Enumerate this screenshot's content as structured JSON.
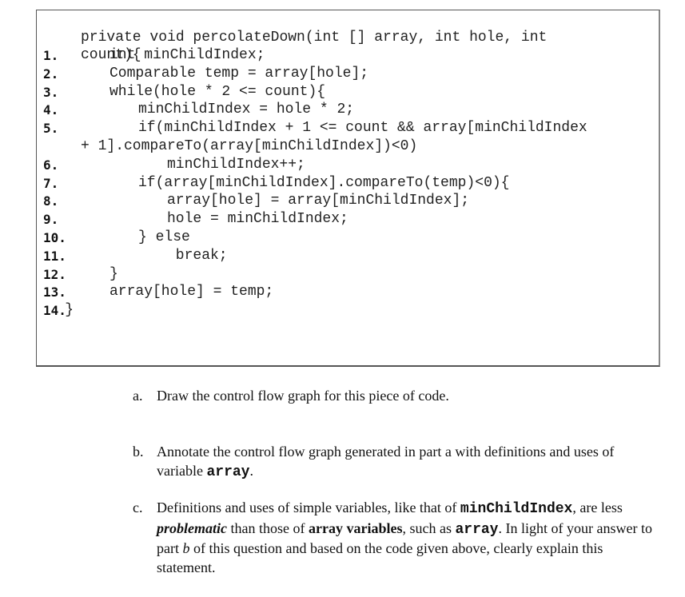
{
  "code": {
    "header": [
      "private void percolateDown(int [] array, int hole, int",
      "count){"
    ],
    "lines": [
      {
        "num": "1.",
        "text": "int minChildIndex;",
        "indent": 1
      },
      {
        "num": "2.",
        "text": "Comparable temp = array[hole];",
        "indent": 1
      },
      {
        "num": "3.",
        "text": "while(hole * 2 <= count){",
        "indent": 1
      },
      {
        "num": "4.",
        "text": "minChildIndex = hole * 2;",
        "indent": 2
      },
      {
        "num": "5.",
        "text": "if(minChildIndex + 1 <= count && array[minChildIndex",
        "indent": 2
      },
      {
        "num": "",
        "text": "+ 1].compareTo(array[minChildIndex])<0)",
        "indent": 0
      },
      {
        "num": "6.",
        "text": "minChildIndex++;",
        "indent": 3
      },
      {
        "num": "7.",
        "text": "if(array[minChildIndex].compareTo(temp)<0){",
        "indent": 2
      },
      {
        "num": "8.",
        "text": "array[hole] = array[minChildIndex];",
        "indent": 3
      },
      {
        "num": "9.",
        "text": "hole = minChildIndex;",
        "indent": 3
      },
      {
        "num": "10.",
        "text": "} else",
        "indent": 2
      },
      {
        "num": "11.",
        "text": "break;",
        "indent": 3.3
      },
      {
        "num": "12.",
        "text": "}",
        "indent": 1
      },
      {
        "num": "13.",
        "text": "array[hole] = temp;",
        "indent": 1
      },
      {
        "num": "14.",
        "text": "}",
        "indent": -0.55
      }
    ]
  },
  "questions": {
    "a": {
      "label": "a.",
      "text": "Draw the control flow graph for this piece of code."
    },
    "b": {
      "label": "b.",
      "text_before": "Annotate the control flow graph generated in part a with definitions and uses of variable ",
      "code": "array",
      "text_after": "."
    },
    "c": {
      "label": "c.",
      "t1": "Definitions and uses of simple variables, like that of ",
      "code1": "minChildIndex",
      "t2": ", are less ",
      "emph1": "problematic",
      "t3": " than those of ",
      "bold1": "array variables",
      "t4": ", such as ",
      "code2": "array",
      "t5": ".  In light of your answer to part ",
      "ital1": "b",
      "t6": " of this question and based on the code given above, clearly explain this statement."
    }
  }
}
